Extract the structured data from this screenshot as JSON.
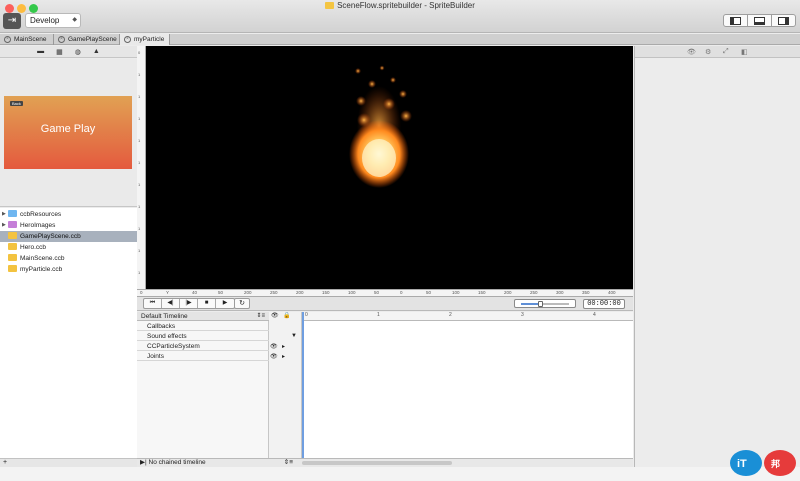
{
  "window": {
    "title": "SceneFlow.spritebuilder - SpriteBuilder"
  },
  "toolbar": {
    "scheme": "Develop"
  },
  "tabs": [
    {
      "label": "MainScene"
    },
    {
      "label": "GamePlayScene"
    },
    {
      "label": "myParticle"
    }
  ],
  "preview": {
    "title": "Game Play",
    "badge": "Back"
  },
  "files": [
    {
      "name": "ccbResources",
      "type": "folder",
      "color": "#6fb6f0"
    },
    {
      "name": "HeroImages",
      "type": "folder",
      "color": "#c57fd8"
    },
    {
      "name": "GamePlayScene.ccb",
      "type": "ccb",
      "color": "#f3c340",
      "selected": true
    },
    {
      "name": "Hero.ccb",
      "type": "ccb",
      "color": "#f3c340"
    },
    {
      "name": "MainScene.ccb",
      "type": "ccb",
      "color": "#f3c340"
    },
    {
      "name": "myParticle.ccb",
      "type": "ccb",
      "color": "#f3c340"
    }
  ],
  "ruler": {
    "h_labels": [
      "0",
      "Y",
      "40",
      "50",
      "200",
      "250",
      "200",
      "150",
      "100",
      "50",
      "0",
      "50",
      "100",
      "150",
      "200",
      "250",
      "300",
      "350",
      "400"
    ],
    "v_labels": [
      "0",
      "1",
      "1",
      "1",
      "1",
      "1",
      "1",
      "1",
      "1",
      "1",
      "1"
    ]
  },
  "playback": {
    "time": "00:00:00",
    "scale": 0.4
  },
  "timeline": {
    "header": "Default Timeline",
    "rows": [
      "Callbacks",
      "Sound effects",
      "CCParticleSystem",
      "Joints"
    ],
    "ruler_labels": [
      "0",
      "1",
      "2",
      "3",
      "4"
    ],
    "chained": "No chained timeline"
  },
  "colors": {
    "accent": "#6f9ee0",
    "selection": "#a8b1bd",
    "canvas": "#000000"
  }
}
